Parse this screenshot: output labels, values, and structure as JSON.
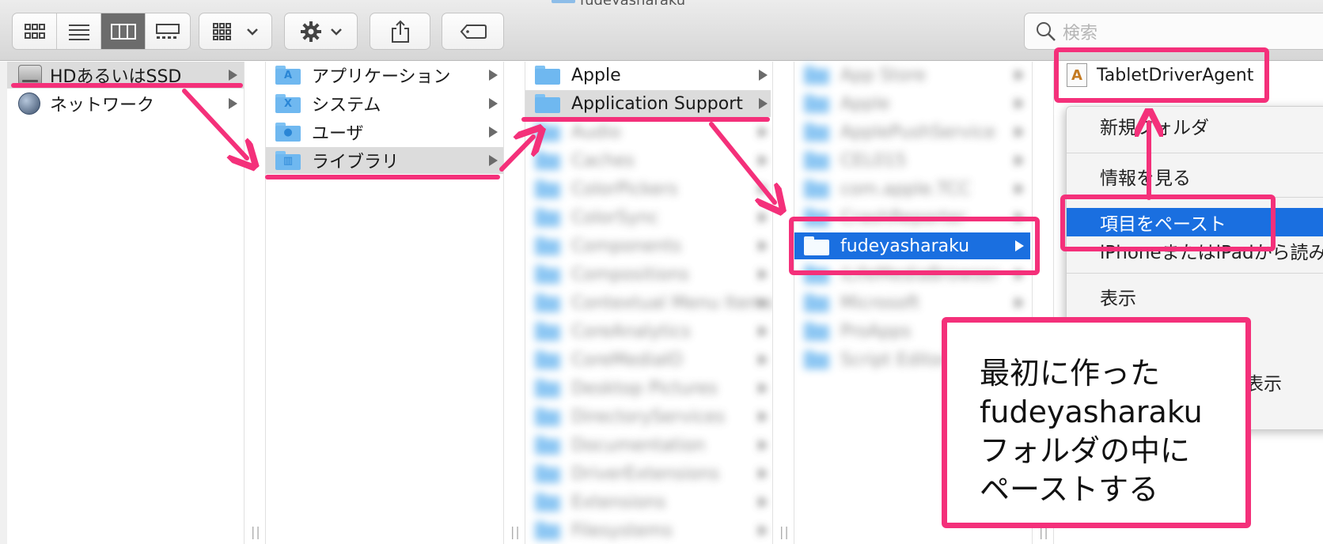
{
  "toolbar": {
    "view_buttons": [
      {
        "name": "icon-view",
        "icon": "grid-icon",
        "active": false
      },
      {
        "name": "list-view",
        "icon": "list-icon",
        "active": false
      },
      {
        "name": "column-view",
        "icon": "columns-icon",
        "active": true
      },
      {
        "name": "gallery-view",
        "icon": "gallery-icon",
        "active": false
      }
    ],
    "group_icon": "group-grid-icon",
    "action_icon": "gear-icon",
    "share_icon": "share-icon",
    "tag_icon": "tag-icon",
    "search": {
      "placeholder": "検索"
    }
  },
  "sidebar": {
    "items": [
      {
        "label": "HDあるいはSSD",
        "icon": "drive-icon",
        "selected": true
      },
      {
        "label": "ネットワーク",
        "icon": "globe-icon",
        "selected": false
      }
    ]
  },
  "column2": {
    "items": [
      {
        "label": "アプリケーション",
        "glyph": "A"
      },
      {
        "label": "システム",
        "glyph": "X"
      },
      {
        "label": "ユーザ",
        "glyph": "●"
      },
      {
        "label": "ライブラリ",
        "glyph": "▥",
        "selected": true
      }
    ]
  },
  "column3": {
    "items": [
      {
        "label": "Apple"
      },
      {
        "label": "Application Support",
        "selected": true
      },
      {
        "label": "Audio"
      },
      {
        "label": "Caches"
      },
      {
        "label": "ColorPickers"
      },
      {
        "label": "ColorSync"
      },
      {
        "label": "Components"
      },
      {
        "label": "Compositions"
      },
      {
        "label": "Contextual Menu Items"
      },
      {
        "label": "CoreAnalytics"
      },
      {
        "label": "CoreMediaIO"
      },
      {
        "label": "Desktop Pictures"
      },
      {
        "label": "DirectoryServices"
      },
      {
        "label": "Documentation"
      },
      {
        "label": "DriverExtensions"
      },
      {
        "label": "Extensions"
      },
      {
        "label": "Filesystems"
      }
    ]
  },
  "column4": {
    "items": [
      {
        "label": "App Store"
      },
      {
        "label": "Apple"
      },
      {
        "label": "ApplePushService"
      },
      {
        "label": "CEL015"
      },
      {
        "label": "com.apple.TCC"
      },
      {
        "label": "CrashReporter"
      },
      {
        "label": "fudeyasharaku",
        "selected": true
      },
      {
        "label": "iLifeMediaBrowser"
      },
      {
        "label": "Microsoft"
      },
      {
        "label": "ProApps"
      },
      {
        "label": "Script Editor"
      }
    ]
  },
  "column5": {
    "items": [
      {
        "label": "TabletDriverAgent",
        "icon": "document-icon"
      }
    ]
  },
  "context_menu": {
    "items": [
      {
        "label": "新規フォルダ"
      },
      {
        "label": "情報を見る"
      },
      {
        "label": "項目をペースト",
        "highlighted": true
      },
      {
        "label": "iPhoneまたはiPadから読み込む"
      },
      {
        "label": "表示"
      },
      {
        "label": "表示オプションを表示"
      }
    ]
  },
  "callout": {
    "lines": [
      "最初に作った",
      "fudeyasharaku",
      "フォルダの中に",
      "ペーストする"
    ]
  },
  "colors": {
    "annotation": "#f4307a",
    "selection": "#1a6fe0",
    "folder": "#6fb8f0"
  },
  "title_fragment": "fudeyasharaku"
}
